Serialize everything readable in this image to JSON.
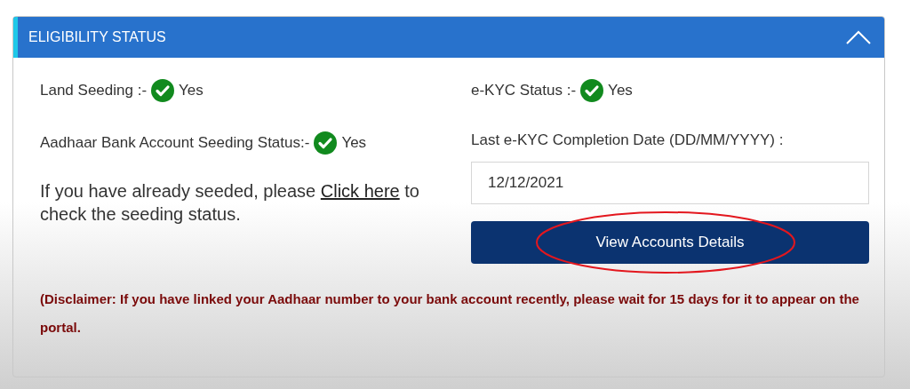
{
  "panel": {
    "title": "ELIGIBILITY STATUS",
    "expanded": true
  },
  "left_items": [
    {
      "label": "Land Seeding :-",
      "value": "Yes",
      "checked": true
    },
    {
      "label": "Aadhaar Bank Account Seeding Status:-",
      "value": "Yes",
      "checked": true
    }
  ],
  "seeding_note": {
    "before": "If you have already seeded, please",
    "link": "Click here",
    "after": "to check the seeding status."
  },
  "ekyc": {
    "label": "e-KYC Status :-",
    "value": "Yes",
    "checked": true
  },
  "date_field": {
    "label": "Last e-KYC Completion Date (DD/MM/YYYY) :",
    "value": "12/12/2021"
  },
  "view_button": {
    "label": "View Accounts Details",
    "circled": true
  },
  "disclaimer": "(Disclaimer: If you have linked your Aadhaar number to your bank account recently, please wait for 15 days for it to appear on the portal."
}
